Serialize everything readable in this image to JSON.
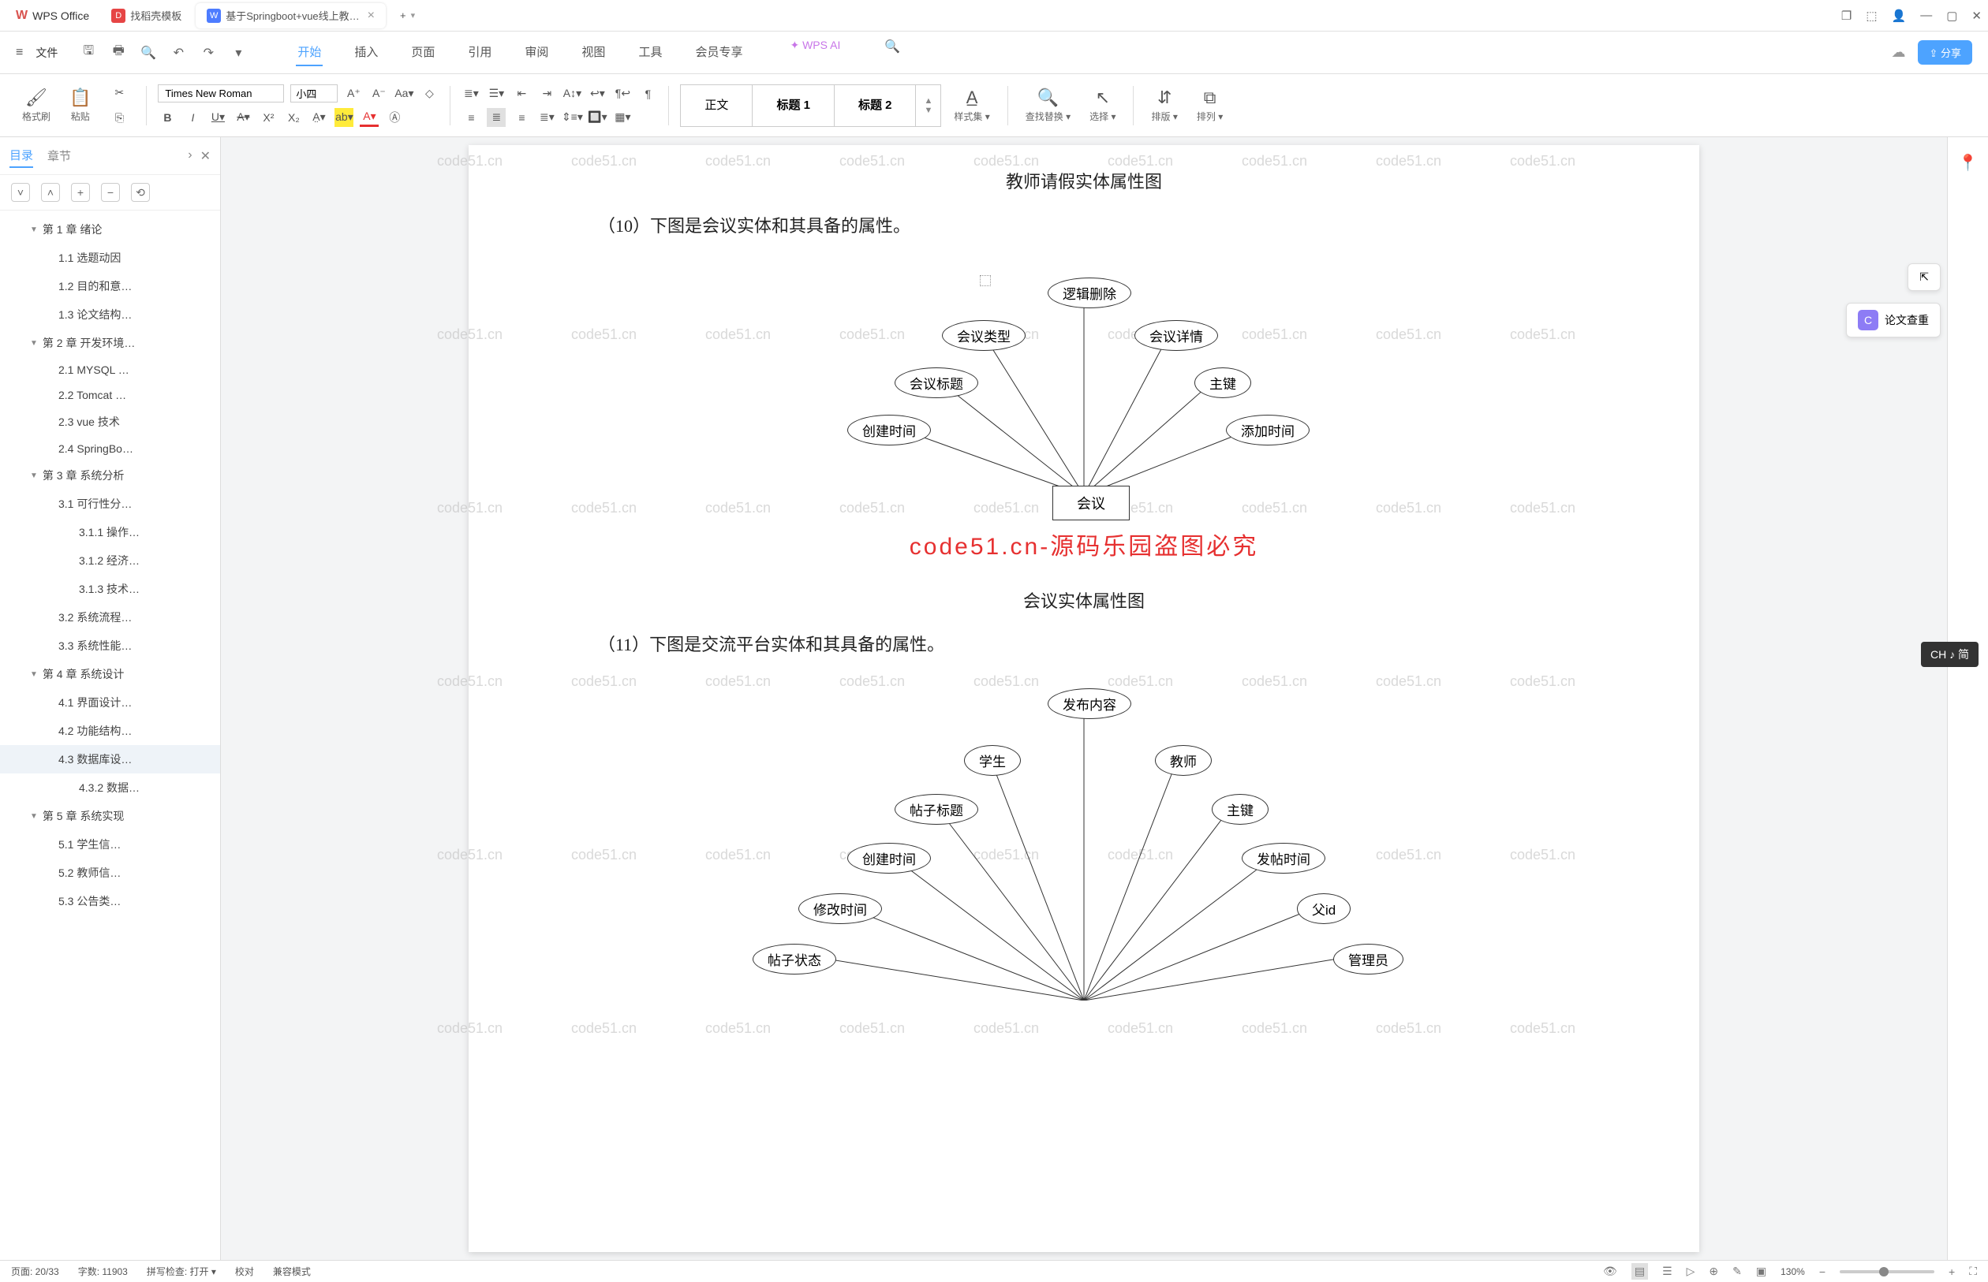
{
  "titlebar": {
    "app": "WPS Office",
    "tab1": "找稻壳模板",
    "tab2": "基于Springboot+vue线上教…",
    "plus": "+",
    "close": "×"
  },
  "menu": {
    "file": "文件",
    "tabs": {
      "start": "开始",
      "insert": "插入",
      "page": "页面",
      "ref": "引用",
      "review": "审阅",
      "view": "视图",
      "tool": "工具",
      "vip": "会员专享"
    },
    "ai": "WPS AI",
    "share": "分享"
  },
  "ribbon": {
    "fmtpaint": "格式刷",
    "paste": "粘贴",
    "font": "Times New Roman",
    "size": "小四",
    "styles": {
      "body": "正文",
      "h1": "标题 1",
      "h2": "标题 2"
    },
    "styleset": "样式集",
    "findrep": "查找替换",
    "select": "选择",
    "sort": "排版",
    "arrange": "排列"
  },
  "sidebar": {
    "t1": "目录",
    "t2": "章节",
    "items": [
      {
        "t": "第 1 章  绪论",
        "l": 1
      },
      {
        "t": "1.1 选题动因",
        "l": 2
      },
      {
        "t": "1.2 目的和意…",
        "l": 2
      },
      {
        "t": "1.3 论文结构…",
        "l": 2
      },
      {
        "t": "第 2 章  开发环境…",
        "l": 1
      },
      {
        "t": "2.1 MYSQL …",
        "l": 2
      },
      {
        "t": "2.2 Tomcat …",
        "l": 2
      },
      {
        "t": "2.3 vue 技术",
        "l": 2
      },
      {
        "t": "2.4 SpringBo…",
        "l": 2
      },
      {
        "t": "第 3 章  系统分析",
        "l": 1
      },
      {
        "t": "3.1 可行性分…",
        "l": 2
      },
      {
        "t": "3.1.1 操作…",
        "l": 3
      },
      {
        "t": "3.1.2 经济…",
        "l": 3
      },
      {
        "t": "3.1.3 技术…",
        "l": 3
      },
      {
        "t": "3.2 系统流程…",
        "l": 2
      },
      {
        "t": "3.3 系统性能…",
        "l": 2
      },
      {
        "t": "第 4 章  系统设计",
        "l": 1
      },
      {
        "t": "4.1 界面设计…",
        "l": 2
      },
      {
        "t": "4.2 功能结构…",
        "l": 2
      },
      {
        "t": "4.3 数据库设…",
        "l": 2,
        "sel": true
      },
      {
        "t": "4.3.2 数据…",
        "l": 3
      },
      {
        "t": "第 5 章  系统实现",
        "l": 1
      },
      {
        "t": "5.1 学生信…",
        "l": 2
      },
      {
        "t": "5.2 教师信…",
        "l": 2
      },
      {
        "t": "5.3 公告类…",
        "l": 2
      }
    ]
  },
  "doc": {
    "caption1": "教师请假实体属性图",
    "line10": "（10）下图是会议实体和其具备的属性。",
    "entity1": "会议",
    "er1": {
      "a1": "逻辑删除",
      "a2": "会议类型",
      "a3": "会议详情",
      "a4": "会议标题",
      "a5": "主键",
      "a6": "创建时间",
      "a7": "添加时间"
    },
    "stamp": "code51.cn-源码乐园盗图必究",
    "caption2": "会议实体属性图",
    "line11": "（11）下图是交流平台实体和其具备的属性。",
    "er2": {
      "a1": "发布内容",
      "a2": "学生",
      "a3": "教师",
      "a4": "帖子标题",
      "a5": "主键",
      "a6": "创建时间",
      "a7": "发帖时间",
      "a8": "修改时间",
      "a9": "父id",
      "a10": "帖子状态",
      "a11": "管理员"
    }
  },
  "float": {
    "b1": "⇱",
    "b2": "论文查重"
  },
  "ime": "CH ♪ 简",
  "status": {
    "page": "页面: 20/33",
    "words": "字数: 11903",
    "spell": "拼写检查: 打开",
    "proof": "校对",
    "compat": "兼容模式",
    "zoom": "130%"
  },
  "watermark": "code51.cn"
}
